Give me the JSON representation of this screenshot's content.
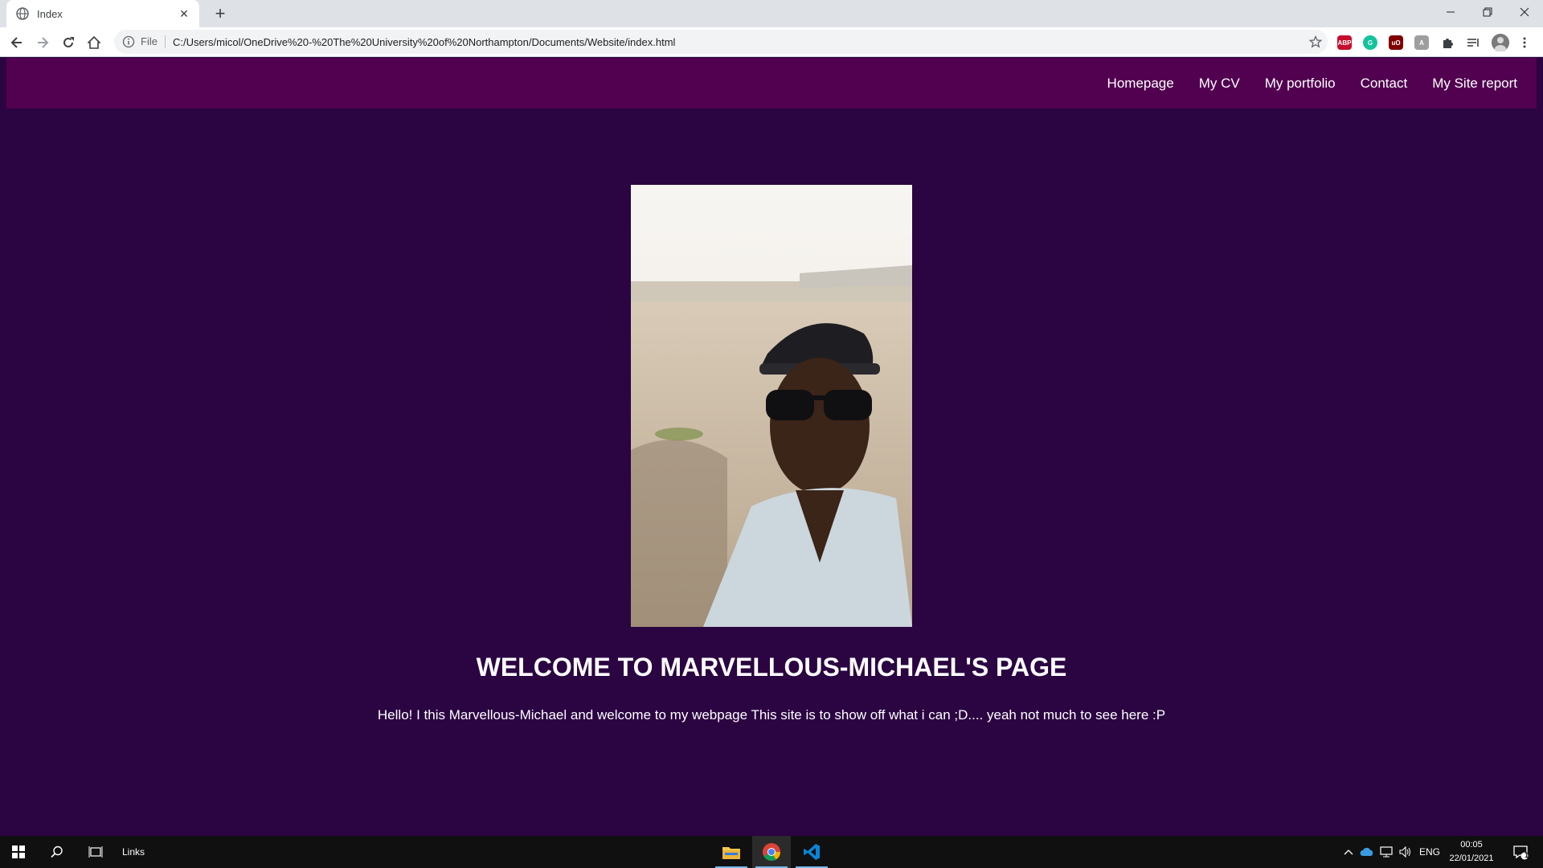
{
  "browser": {
    "tab_title": "Index",
    "tab_close": "✕",
    "new_tab": "+",
    "url_scheme": "File",
    "url": "C:/Users/micol/OneDrive%20-%20The%20University%20of%20Northampton/Documents/Website/index.html",
    "extensions": [
      {
        "name": "adblock-plus-icon",
        "label": "ABP",
        "color": "#c70d2c"
      },
      {
        "name": "grammarly-icon",
        "label": "G",
        "color": "#15c39a"
      },
      {
        "name": "ublock-origin-icon",
        "label": "uO",
        "color": "#800000"
      },
      {
        "name": "generic-extension-icon",
        "label": "A",
        "color": "#9e9e9e"
      }
    ]
  },
  "site": {
    "nav": [
      "Homepage",
      "My CV",
      "My portfolio",
      "Contact",
      "My Site report"
    ],
    "heading": "WELCOME TO MARVELLOUS-MICHAEL'S PAGE",
    "intro": "Hello! I this Marvellous-Michael and welcome to my webpage This site is to show off what i can ;D.... yeah not much to see here :P"
  },
  "taskbar": {
    "links_label": "Links",
    "language": "ENG",
    "time": "00:05",
    "date": "22/01/2021",
    "notification_count": "1"
  },
  "colors": {
    "page_bg": "#2b0442",
    "nav_bg": "#510150",
    "text": "#ffffff"
  }
}
